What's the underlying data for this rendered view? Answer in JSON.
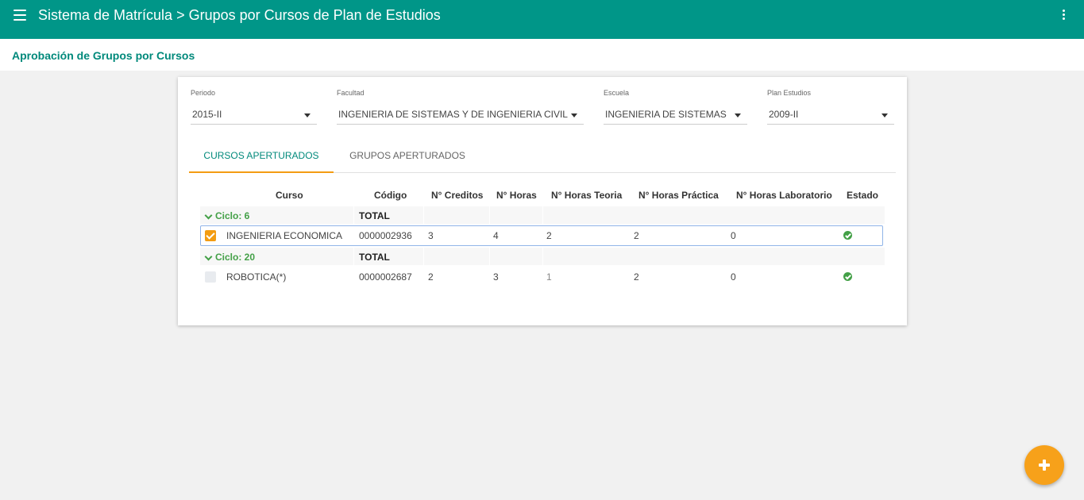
{
  "header": {
    "title": "Sistema de Matrícula > Grupos por Cursos de Plan de Estudios"
  },
  "page_title": "Aprobación de Grupos por Cursos",
  "filters": {
    "periodo": {
      "label": "Periodo",
      "value": "2015-II"
    },
    "facultad": {
      "label": "Facultad",
      "value": "INGENIERIA DE SISTEMAS Y DE INGENIERIA CIVIL"
    },
    "escuela": {
      "label": "Escuela",
      "value": "INGENIERIA DE SISTEMAS"
    },
    "plan": {
      "label": "Plan Estudios",
      "value": "2009-II"
    }
  },
  "tabs": [
    {
      "label": "CURSOS APERTURADOS",
      "active": true
    },
    {
      "label": "GRUPOS APERTURADOS",
      "active": false
    }
  ],
  "table": {
    "columns": [
      "Curso",
      "Código",
      "N° Creditos",
      "N° Horas",
      "N° Horas Teoria",
      "N° Horas Práctica",
      "N° Horas Laboratorio",
      "Estado"
    ],
    "groups": [
      {
        "label": "Ciclo: 6",
        "total_label": "TOTAL",
        "rows": [
          {
            "checked": true,
            "curso": "INGENIERIA ECONOMICA",
            "codigo": "0000002936",
            "creditos": "3",
            "horas": "4",
            "teoria": "2",
            "practica": "2",
            "laboratorio": "0",
            "estado": "ok"
          }
        ]
      },
      {
        "label": "Ciclo: 20",
        "total_label": "TOTAL",
        "rows": [
          {
            "checked": false,
            "curso": "ROBOTICA(*)",
            "codigo": "0000002687",
            "creditos": "2",
            "horas": "3",
            "teoria": "1",
            "practica": "2",
            "laboratorio": "0",
            "estado": "ok"
          }
        ]
      }
    ]
  },
  "colors": {
    "primary": "#009688",
    "accent": "#f39c12",
    "success": "#43a047"
  }
}
